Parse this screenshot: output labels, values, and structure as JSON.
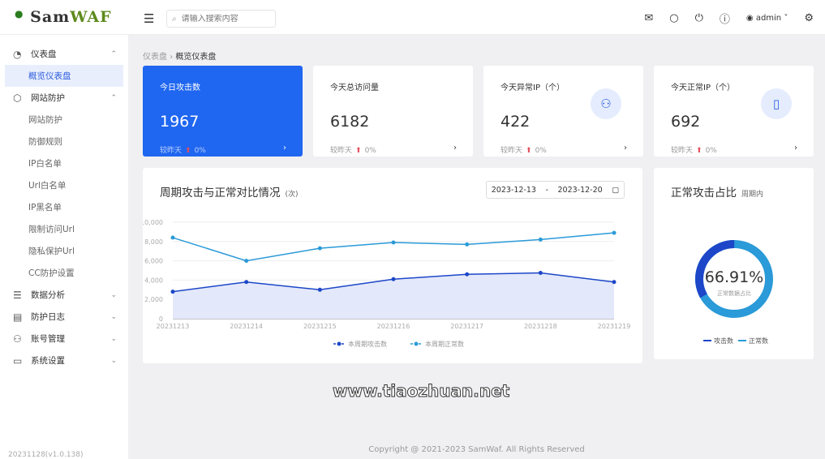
{
  "header": {
    "logo": "SamWAF",
    "logo_sam": "Sam",
    "logo_waf": "WAF",
    "search_placeholder": "请输入搜索内容",
    "user": "admin"
  },
  "sidebar": {
    "items": [
      {
        "label": "仪表盘",
        "icon": "dashboard-icon",
        "type": "group",
        "expanded": true
      },
      {
        "label": "概览仪表盘",
        "type": "sub",
        "active": true
      },
      {
        "label": "网站防护",
        "icon": "shield-icon",
        "type": "group",
        "expanded": true
      },
      {
        "label": "网站防护",
        "type": "sub"
      },
      {
        "label": "防御规则",
        "type": "sub"
      },
      {
        "label": "IP白名单",
        "type": "sub"
      },
      {
        "label": "Url白名单",
        "type": "sub"
      },
      {
        "label": "IP黑名单",
        "type": "sub"
      },
      {
        "label": "限制访问Url",
        "type": "sub"
      },
      {
        "label": "隐私保护Url",
        "type": "sub"
      },
      {
        "label": "CC防护设置",
        "type": "sub"
      },
      {
        "label": "数据分析",
        "icon": "chart-icon",
        "type": "group",
        "expanded": false
      },
      {
        "label": "防护日志",
        "icon": "log-icon",
        "type": "group",
        "expanded": false
      },
      {
        "label": "账号管理",
        "icon": "users-icon",
        "type": "group",
        "expanded": false
      },
      {
        "label": "系统设置",
        "icon": "settings-icon",
        "type": "group",
        "expanded": false
      }
    ],
    "version": "20231128(v1.0.138)"
  },
  "breadcrumb": {
    "parent": "仪表盘",
    "current": "概览仪表盘"
  },
  "stats": [
    {
      "title": "今日攻击数",
      "value": "1967",
      "compare": "较昨天",
      "change": "0%"
    },
    {
      "title": "今天总访问量",
      "value": "6182",
      "compare": "较昨天",
      "change": "0%"
    },
    {
      "title": "今天异常IP（个）",
      "value": "422",
      "compare": "较昨天",
      "change": "0%",
      "icon": "users-icon"
    },
    {
      "title": "今天正常IP（个）",
      "value": "692",
      "compare": "较昨天",
      "change": "0%",
      "icon": "file-icon"
    }
  ],
  "trend": {
    "title": "周期攻击与正常对比情况",
    "unit": "(次)",
    "date_start": "2023-12-13",
    "date_sep": "-",
    "date_end": "2023-12-20"
  },
  "pie": {
    "title": "正常攻击占比",
    "subtitle": "周期内",
    "percent": "66.91%",
    "center_label": "正常数据占比",
    "legend": [
      "攻击数",
      "正常数"
    ]
  },
  "chart_data": {
    "type": "line",
    "categories": [
      "20231213",
      "20231214",
      "20231215",
      "20231216",
      "20231217",
      "20231218",
      "20231219"
    ],
    "yticks": [
      "0",
      "2,000",
      "4,000",
      "6,000",
      "8,000",
      "10,000"
    ],
    "ylim": [
      0,
      10000
    ],
    "legend_position": "bottom",
    "series": [
      {
        "name": "本周期攻击数",
        "color": "#1d47c8",
        "values": [
          2800,
          3800,
          3000,
          4100,
          4600,
          4750,
          3800
        ]
      },
      {
        "name": "本周期正常数",
        "color": "#2a9ad8",
        "values": [
          8400,
          6000,
          7300,
          7900,
          7700,
          8200,
          8900
        ]
      }
    ]
  },
  "footer": "Copyright @ 2021-2023 SamWaf. All Rights Reserved",
  "watermark": "www.tiaozhuan.net"
}
